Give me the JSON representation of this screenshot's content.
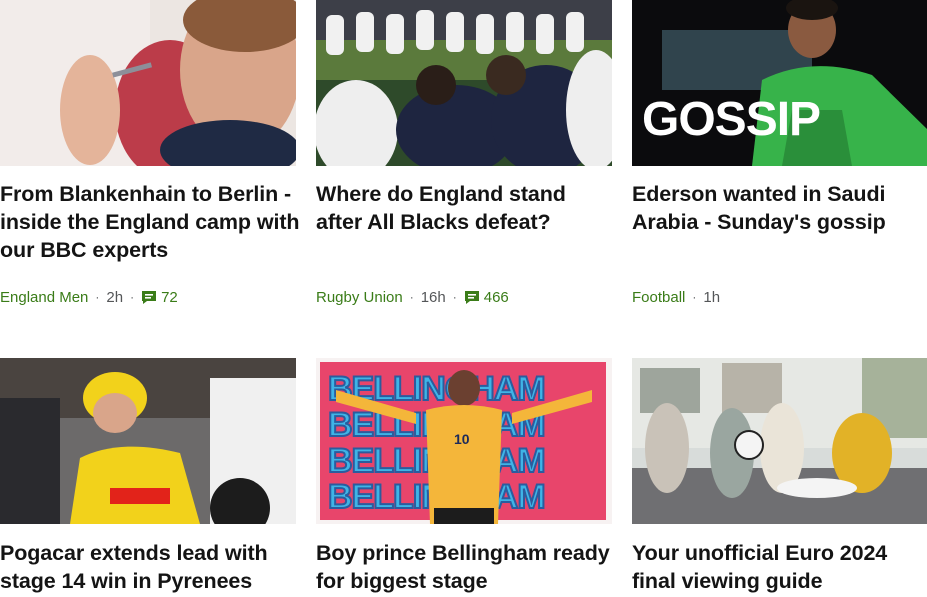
{
  "cards": [
    {
      "title": "From Blankenhain to Berlin - inside the England camp with our BBC experts",
      "section": "England Men",
      "time": "2h",
      "comments": "72",
      "image_alt": "Harry Kane holding a dart"
    },
    {
      "title": "Where do England stand after All Blacks defeat?",
      "section": "Rugby Union",
      "time": "16h",
      "comments": "466",
      "image_alt": "England rugby players in a huddle"
    },
    {
      "title": "Ederson wanted in Saudi Arabia - Sunday's gossip",
      "section": "Football",
      "time": "1h",
      "image_word": "GOSSIP",
      "image_alt": "Ederson in a green goalkeeper kit"
    },
    {
      "title": "Pogacar extends lead with stage 14 win in Pyrenees",
      "image_alt": "Tadej Pogacar in the yellow jersey"
    },
    {
      "title": "Boy prince Bellingham ready for biggest stage",
      "image_word": "BELLINGHAM",
      "shirt_number": "10",
      "image_alt": "Jude Bellingham with arms outstretched"
    },
    {
      "title": "Your unofficial Euro 2024 final viewing guide",
      "image_alt": "Friends celebrating on a sofa watching football"
    }
  ],
  "colors": {
    "section_link": "#3a7c18",
    "meta_text": "#545658",
    "title_text": "#141414"
  },
  "icons": {
    "comments": "speech-bubble-icon"
  }
}
